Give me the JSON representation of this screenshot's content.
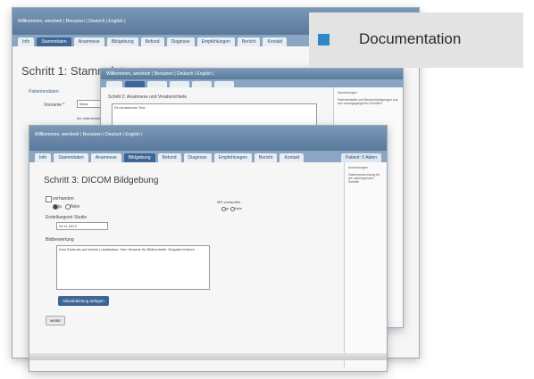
{
  "win1": {
    "header_text": "Willkommen, werdredr | Benutzen | Deutsch | English |",
    "tabs": [
      "Info",
      "Stammdaten",
      "Anamnese",
      "Bildgebung",
      "Befund",
      "Diagnose",
      "Empfehlungen",
      "Bericht",
      "Kontakt"
    ],
    "heading": "Schritt 1: Stammdaten",
    "section_label": "Patientendaten",
    "name_label": "Vorname *",
    "name_value": "Ilmas",
    "next_label": "Ich unterschreibe"
  },
  "win2": {
    "header_text": "Willkommen, werdredr | Benutzen | Deutsch | English |",
    "heading": "Schritt 2: Anamnese und Voraberichtete",
    "textarea_value": "Ein Anamnese-Text",
    "side_text1": "Anmerkungen",
    "side_text2": "Patientenseite und Benachrichtigungen aus den vorangegangenen Schritten"
  },
  "win3": {
    "header_text": "Willkommen, werdredr | Benutzen | Deutsch | English |",
    "tabs": [
      "Info",
      "Stammdaten",
      "Anamnese",
      "Bildgebung",
      "Befund",
      "Diagnose",
      "Empfehlungen",
      "Bericht",
      "Kontakt"
    ],
    "right_tab": "Patient: 5 Akten",
    "heading": "Schritt 3: DICOM Bildgebung",
    "checkbox_label": "vorhanden",
    "radio_ja": "ja",
    "radio_nein": "Nein",
    "date_label": "Erstellungsort Studie",
    "date_value": "04.11.2013",
    "mr_label": "MR vorhanden",
    "mr_ja": "ja",
    "mr_nein": "Nein",
    "befund_label": "Bildbewertung",
    "befund_text": "Kein Eindruck auf leichte Lokalisation. Kein Hinweis für Bildkontrolle. Eingabe fehlend.",
    "button_add": "Aktivabbildung anfügen",
    "button_next": "weiter",
    "side_text1": "Anmerkungen",
    "side_text2": "Datenversammlung für die nachfolgenden Schritte"
  },
  "doc_label": "Documentation",
  "colors": {
    "accent": "#3d6694",
    "marker": "#2f86c8"
  }
}
